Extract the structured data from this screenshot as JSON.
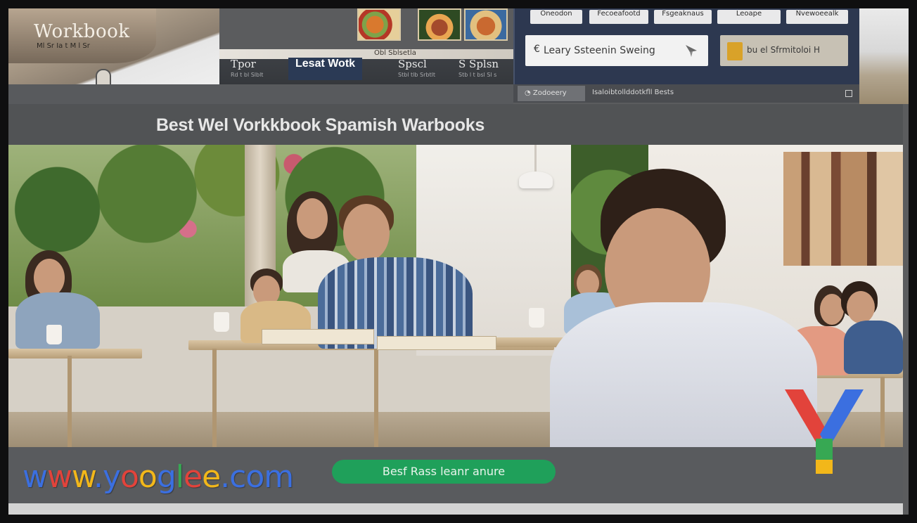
{
  "header": {
    "logo_title": "Workbook",
    "logo_subtitle": "Ml Sr Ia t M l Sr",
    "stripe_text": "Obl Sblsetla",
    "nav": [
      {
        "label": "Tpor",
        "sub": "Rd t bl Slblt"
      },
      {
        "label": "Lesat Wotk",
        "sub": ""
      },
      {
        "label": "Spscl",
        "sub": "Stbl tlb Srbtlt"
      },
      {
        "label": "S Splsn",
        "sub": "Stb l t bsl Sl s"
      }
    ]
  },
  "top_panel": {
    "pills": [
      "Oneodon",
      "Fecoeafootd",
      "Fsgeaknaus",
      "Leoape",
      "Nvewoeealk"
    ],
    "search": {
      "prefix": "€",
      "placeholder": "Leary Ssteenin Sweing"
    },
    "button_label": "bu el Sfrmitoloi H",
    "address_chip": "Zodoeery",
    "address_path": "Isaloibtollddotkfll Bests"
  },
  "headline": "Best Wel Vorkkbook Spamish Warbooks",
  "footer": {
    "url_parts": [
      {
        "text": "w",
        "color": "#3b6fe0"
      },
      {
        "text": "w",
        "color": "#e2433b"
      },
      {
        "text": "w",
        "color": "#f2b71a"
      },
      {
        "text": ".",
        "color": "#3b6fe0"
      },
      {
        "text": "y",
        "color": "#3b6fe0"
      },
      {
        "text": "o",
        "color": "#e2433b"
      },
      {
        "text": "o",
        "color": "#f2b71a"
      },
      {
        "text": "g",
        "color": "#3b6fe0"
      },
      {
        "text": "l",
        "color": "#37a853"
      },
      {
        "text": "e",
        "color": "#e2433b"
      },
      {
        "text": "e",
        "color": "#f2b71a"
      },
      {
        "text": ".",
        "color": "#3b6fe0"
      },
      {
        "text": "c",
        "color": "#3b6fe0"
      },
      {
        "text": "o",
        "color": "#3b6fe0"
      },
      {
        "text": "m",
        "color": "#3b6fe0"
      }
    ],
    "cta_label": "Besf Rass leanr anure"
  },
  "colors": {
    "accent_green": "#1fa05a",
    "nav_active": "#2b3a55",
    "panel_bg": "#2d3850",
    "logo_red": "#e2433b",
    "logo_blue": "#3b6fe0",
    "logo_green": "#37a853",
    "logo_yellow": "#f2b71a"
  }
}
